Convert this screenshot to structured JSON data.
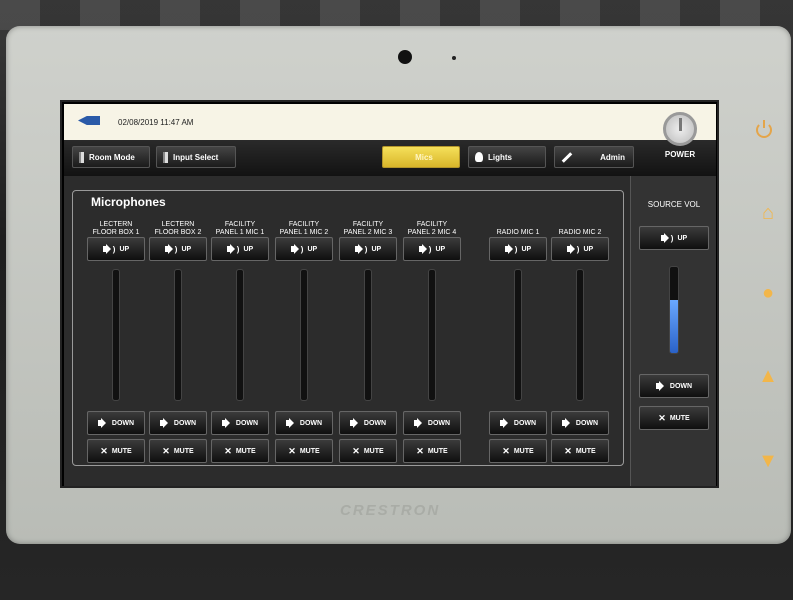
{
  "device": {
    "brand": "CRESTRON"
  },
  "status_bar": {
    "datetime": "02/08/2019 11:47 AM"
  },
  "nav": {
    "room_mode": "Room Mode",
    "input_select": "Input Select",
    "mics": "Mics",
    "lights": "Lights",
    "admin": "Admin",
    "power": "POWER"
  },
  "microphones": {
    "title": "Microphones",
    "channels": [
      {
        "label_line1": "LECTERN",
        "label_line2": "FLOOR BOX 1",
        "up": "UP",
        "down": "DOWN",
        "mute": "MUTE"
      },
      {
        "label_line1": "LECTERN",
        "label_line2": "FLOOR BOX 2",
        "up": "UP",
        "down": "DOWN",
        "mute": "MUTE"
      },
      {
        "label_line1": "FACILITY",
        "label_line2": "PANEL 1 MIC 1",
        "up": "UP",
        "down": "DOWN",
        "mute": "MUTE"
      },
      {
        "label_line1": "FACILITY",
        "label_line2": "PANEL 1 MIC 2",
        "up": "UP",
        "down": "DOWN",
        "mute": "MUTE"
      },
      {
        "label_line1": "FACILITY",
        "label_line2": "PANEL 2 MIC 3",
        "up": "UP",
        "down": "DOWN",
        "mute": "MUTE"
      },
      {
        "label_line1": "FACILITY",
        "label_line2": "PANEL 2 MIC 4",
        "up": "UP",
        "down": "DOWN",
        "mute": "MUTE"
      },
      {
        "label_line1": "",
        "label_line2": "RADIO MIC 1",
        "up": "UP",
        "down": "DOWN",
        "mute": "MUTE"
      },
      {
        "label_line1": "",
        "label_line2": "RADIO MIC 2",
        "up": "UP",
        "down": "DOWN",
        "mute": "MUTE"
      }
    ]
  },
  "source_volume": {
    "label": "SOURCE VOL",
    "up": "UP",
    "down": "DOWN",
    "mute": "MUTE",
    "level_pct": 62
  },
  "colors": {
    "active_tab": "#e8c944",
    "fader_fill": "#2a62c8",
    "side_keys": "#f2b64a"
  }
}
